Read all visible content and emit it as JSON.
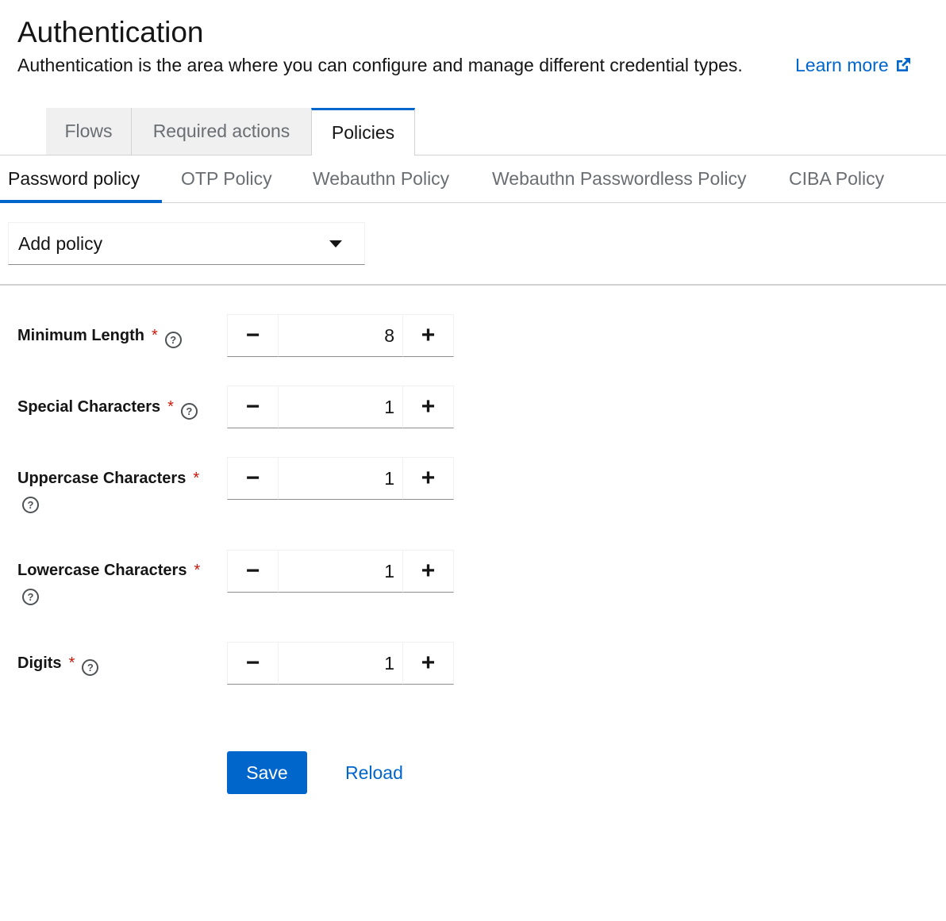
{
  "header": {
    "title": "Authentication",
    "description": "Authentication is the area where you can configure and manage different credential types.",
    "learn_more": "Learn more"
  },
  "main_tabs": [
    {
      "label": "Flows"
    },
    {
      "label": "Required actions"
    },
    {
      "label": "Policies",
      "active": true
    }
  ],
  "sub_tabs": [
    {
      "label": "Password policy",
      "active": true
    },
    {
      "label": "OTP Policy"
    },
    {
      "label": "Webauthn Policy"
    },
    {
      "label": "Webauthn Passwordless Policy"
    },
    {
      "label": "CIBA Policy"
    }
  ],
  "add_policy": {
    "label": "Add policy"
  },
  "policies": [
    {
      "label": "Minimum Length",
      "required": "*",
      "value": "8"
    },
    {
      "label": "Special Characters",
      "required": "*",
      "value": "1"
    },
    {
      "label": "Uppercase Characters",
      "required": "*",
      "value": "1"
    },
    {
      "label": "Lowercase Characters",
      "required": "*",
      "value": "1"
    },
    {
      "label": "Digits",
      "required": "*",
      "value": "1"
    }
  ],
  "actions": {
    "save": "Save",
    "reload": "Reload"
  },
  "icons": {
    "help": "help-icon",
    "external_link": "external-link-icon",
    "minus": "minus-icon",
    "plus": "plus-icon",
    "caret": "caret-down-icon"
  },
  "colors": {
    "primary": "#0066cc",
    "required": "#c9190b",
    "text": "#151515",
    "muted": "#6a6e73",
    "border": "#d2d2d2"
  }
}
